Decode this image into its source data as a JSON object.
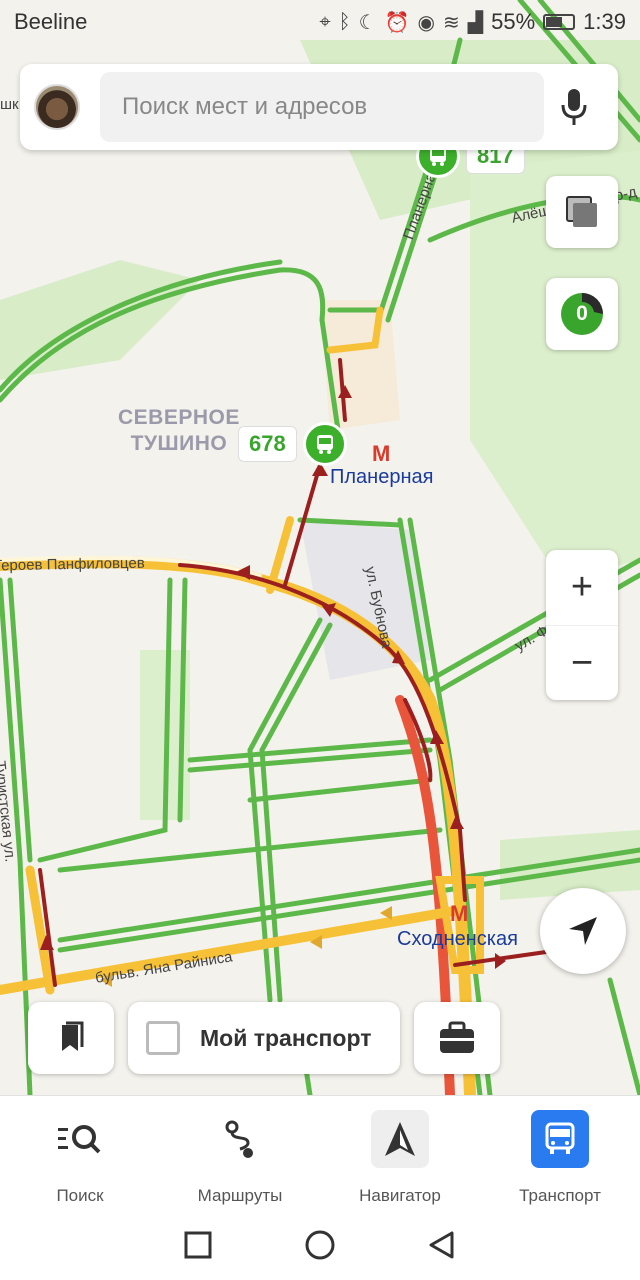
{
  "status": {
    "carrier": "Beeline",
    "battery": "55%",
    "battery_level": 0.55,
    "time": "1:39"
  },
  "search": {
    "placeholder": "Поиск мест и адресов"
  },
  "map": {
    "district": "СЕВЕРНОЕ\nТУШИНО",
    "traffic_score": "0",
    "metro": [
      {
        "name": "Планерная"
      },
      {
        "name": "Сходненская"
      }
    ],
    "streets": [
      "Героев Панфиловцев",
      "ул. Бубнова",
      "ул. Фомичевой",
      "Туристская ул.",
      "бульв. Яна Райниса",
      "Планерная",
      "Алёшкинский пр-д",
      "шк"
    ],
    "buses": [
      {
        "number": "817"
      },
      {
        "number": "678"
      }
    ]
  },
  "controls": {
    "my_transport": "Мой транспорт"
  },
  "nav": {
    "items": [
      {
        "label": "Поиск",
        "icon": "search-list-icon"
      },
      {
        "label": "Маршруты",
        "icon": "route-icon"
      },
      {
        "label": "Навигатор",
        "icon": "navigator-icon"
      },
      {
        "label": "Транспорт",
        "icon": "bus-icon",
        "active": true
      }
    ]
  },
  "colors": {
    "road": "#5db84a",
    "accent": "#2b7bf0",
    "traffic_red": "#9b1f1f",
    "traffic_yellow": "#f7c137",
    "green_area": "#d7ecc7"
  }
}
